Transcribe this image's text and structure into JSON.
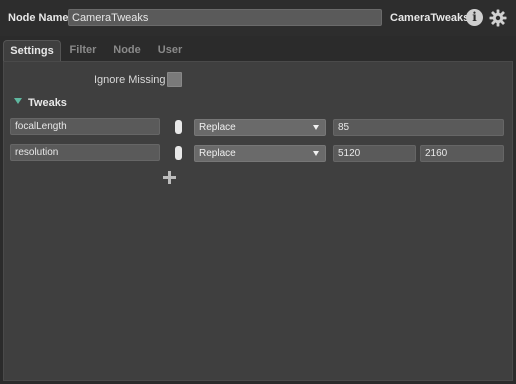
{
  "header": {
    "node_name_label": "Node Name",
    "node_name_value": "CameraTweaks",
    "node_type": "CameraTweaks",
    "info_glyph": "i"
  },
  "tabs": [
    {
      "label": "Settings",
      "active": true
    },
    {
      "label": "Filter",
      "active": false
    },
    {
      "label": "Node",
      "active": false
    },
    {
      "label": "User",
      "active": false
    }
  ],
  "settings": {
    "ignore_missing_label": "Ignore Missing",
    "ignore_missing_checked": false,
    "group_title": "Tweaks",
    "tweaks": [
      {
        "name": "focalLength",
        "enabled": true,
        "mode": "Replace",
        "values": [
          "85"
        ]
      },
      {
        "name": "resolution",
        "enabled": true,
        "mode": "Replace",
        "values": [
          "5120",
          "2160"
        ]
      }
    ]
  },
  "colors": {
    "background": "#2b2b2b",
    "panel": "#3f3f3f",
    "accent_arrow": "#5fb8a0"
  },
  "icons": {
    "info": "info-icon",
    "settings": "gear-icon",
    "add": "plus-icon",
    "expand": "triangle-down-icon"
  }
}
